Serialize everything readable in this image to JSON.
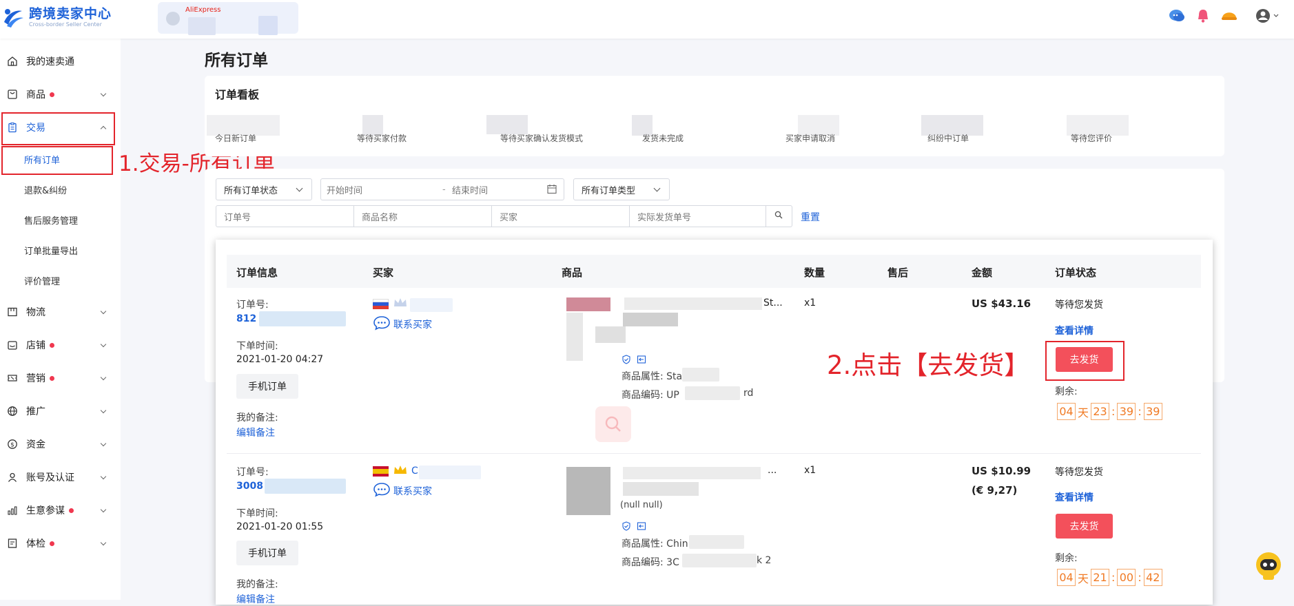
{
  "app": {
    "title": "跨境卖家中心",
    "subtitle": "Cross-border Seller Center"
  },
  "store": {
    "brand": "AliExpress"
  },
  "sidebar": {
    "items": [
      {
        "label": "我的速卖通",
        "dot": false
      },
      {
        "label": "商品",
        "dot": true
      },
      {
        "label": "交易",
        "dot": false
      },
      {
        "label": "物流",
        "dot": false
      },
      {
        "label": "店铺",
        "dot": true
      },
      {
        "label": "营销",
        "dot": true
      },
      {
        "label": "推广",
        "dot": false
      },
      {
        "label": "资金",
        "dot": false
      },
      {
        "label": "账号及认证",
        "dot": false
      },
      {
        "label": "生意参谋",
        "dot": true
      },
      {
        "label": "体检",
        "dot": true
      }
    ],
    "sub_items": [
      "所有订单",
      "退款&纠纷",
      "售后服务管理",
      "订单批量导出",
      "评价管理"
    ]
  },
  "annotations": {
    "step1": "1.交易-所有订单",
    "step2": "2.点击【去发货】"
  },
  "page": {
    "title": "所有订单"
  },
  "board": {
    "title": "订单看板",
    "stats": [
      "今日新订单",
      "等待买家付款",
      "等待买家确认发货模式",
      "发货未完成",
      "买家申请取消",
      "纠纷中订单",
      "等待您评价"
    ]
  },
  "filters": {
    "status": "所有订单状态",
    "start_time": "开始时间",
    "end_time": "结束时间",
    "type": "所有订单类型",
    "order_no": "订单号",
    "product_name": "商品名称",
    "buyer": "买家",
    "tracking_no": "实际发货单号",
    "reset": "重置"
  },
  "table": {
    "headers": [
      "订单信息",
      "买家",
      "商品",
      "数量",
      "售后",
      "金额",
      "订单状态"
    ],
    "rows": [
      {
        "order_label": "订单号:",
        "order_no": "812",
        "time_label": "下单时间:",
        "time": "2021-01-20 04:27",
        "source": "手机订单",
        "note_label": "我的备注:",
        "note_link": "编辑备注",
        "contact": "联系买家",
        "product_tail": "St...",
        "attr_label": "商品属性: Sta",
        "code_label": "商品编码: UP",
        "code_tail": "rd",
        "qty": "x1",
        "amount": "US $43.16",
        "amount2": "",
        "status": "等待您发货",
        "detail": "查看详情",
        "ship": "去发货",
        "remain": "剩余:",
        "countdown": [
          "04",
          "天",
          "23",
          ":",
          "39",
          ":",
          "39"
        ]
      },
      {
        "order_label": "订单号:",
        "order_no": "3008",
        "time_label": "下单时间:",
        "time": "2021-01-20 01:55",
        "source": "手机订单",
        "note_label": "我的备注:",
        "note_link": "编辑备注",
        "contact": "联系买家",
        "buyer_initial": "C",
        "product_tail": "...",
        "product_line2": "(null null)",
        "attr_label": "商品属性: Chin",
        "code_label": "商品编码: 3C",
        "code_tail": "k 2",
        "qty": "x1",
        "amount": "US $10.99",
        "amount2": "(€ 9,27)",
        "status": "等待您发货",
        "detail": "查看详情",
        "ship": "去发货",
        "remain": "剩余:",
        "countdown": [
          "04",
          "天",
          "21",
          ":",
          "00",
          ":",
          "42"
        ]
      }
    ]
  },
  "colors": {
    "brand": "#1e62d8",
    "annotation": "#e3242b",
    "ship_button": "#f3505b",
    "countdown": "#f07a24"
  }
}
